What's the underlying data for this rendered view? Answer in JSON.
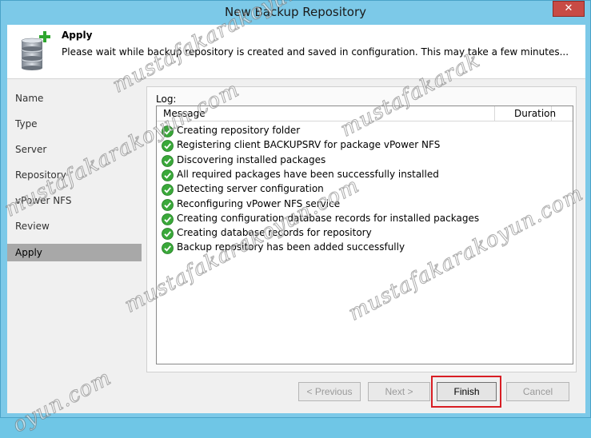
{
  "window": {
    "title": "New Backup Repository",
    "close_label": "✕"
  },
  "header": {
    "title": "Apply",
    "description": "Please wait while backup repository is created and saved in configuration. This may take a few minutes...",
    "icon": "database-add-icon"
  },
  "nav": {
    "items": [
      {
        "label": "Name"
      },
      {
        "label": "Type"
      },
      {
        "label": "Server"
      },
      {
        "label": "Repository"
      },
      {
        "label": "vPower NFS"
      },
      {
        "label": "Review"
      },
      {
        "label": "Apply",
        "active": true
      }
    ]
  },
  "log": {
    "label": "Log:",
    "columns": {
      "message": "Message",
      "duration": "Duration"
    },
    "rows": [
      {
        "message": "Creating repository folder",
        "status": "success"
      },
      {
        "message": "Registering client BACKUPSRV for package vPower NFS",
        "status": "success"
      },
      {
        "message": "Discovering installed packages",
        "status": "success"
      },
      {
        "message": "All required packages have been successfully installed",
        "status": "success"
      },
      {
        "message": "Detecting server configuration",
        "status": "success"
      },
      {
        "message": "Reconfiguring vPower NFS service",
        "status": "success"
      },
      {
        "message": "Creating configuration database records for installed packages",
        "status": "success"
      },
      {
        "message": "Creating database records for repository",
        "status": "success"
      },
      {
        "message": "Backup repository has been added successfully",
        "status": "success"
      }
    ]
  },
  "buttons": {
    "previous": "< Previous",
    "next": "Next >",
    "finish": "Finish",
    "cancel": "Cancel"
  },
  "watermark": {
    "text": "mustafakarakoyun.com",
    "short": "mustafakarak",
    "tail": "oyun.com"
  },
  "colors": {
    "success": "#3aa83a",
    "highlight": "#d81e24",
    "title_bg": "#7cc9e8"
  }
}
